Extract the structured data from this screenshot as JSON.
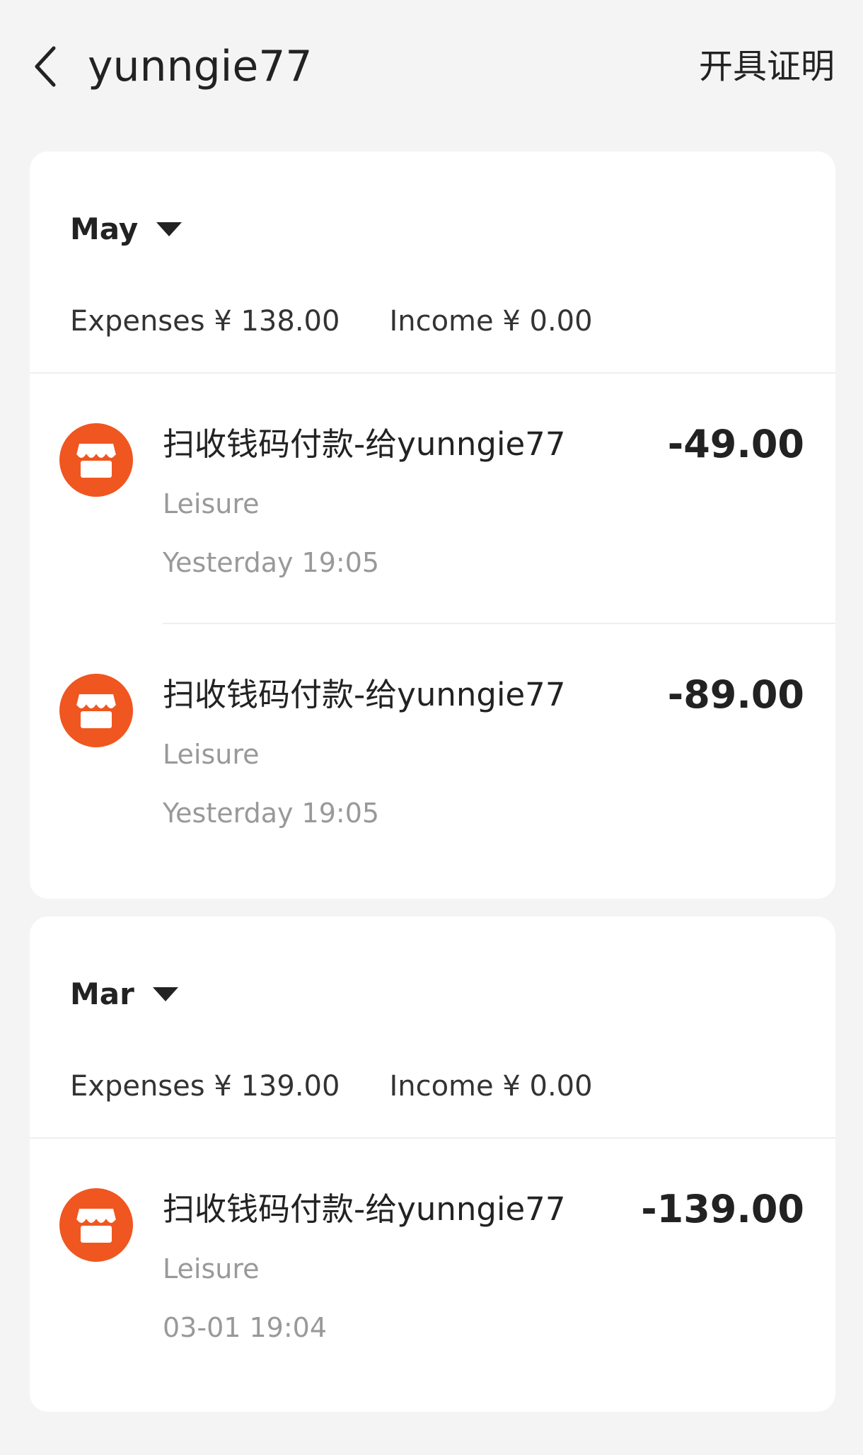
{
  "header": {
    "title": "yunngie77",
    "action_label": "开具证明",
    "back_icon": "chevron-left-icon"
  },
  "groups": [
    {
      "month": "May",
      "expenses_label": "Expenses",
      "expenses_value": "¥ 138.00",
      "income_label": "Income",
      "income_value": "¥ 0.00",
      "transactions": [
        {
          "icon": "store-icon",
          "name": "扫收钱码付款-给yunngie77",
          "category": "Leisure",
          "time": "Yesterday 19:05",
          "amount": "-49.00"
        },
        {
          "icon": "store-icon",
          "name": "扫收钱码付款-给yunngie77",
          "category": "Leisure",
          "time": "Yesterday 19:05",
          "amount": "-89.00"
        }
      ]
    },
    {
      "month": "Mar",
      "expenses_label": "Expenses",
      "expenses_value": "¥ 139.00",
      "income_label": "Income",
      "income_value": "¥ 0.00",
      "transactions": [
        {
          "icon": "store-icon",
          "name": "扫收钱码付款-给yunngie77",
          "category": "Leisure",
          "time": "03-01 19:04",
          "amount": "-139.00"
        }
      ]
    }
  ],
  "colors": {
    "accent": "#f0561f",
    "background": "#f4f4f4",
    "card": "#ffffff",
    "text": "#222222",
    "muted": "#999999"
  }
}
